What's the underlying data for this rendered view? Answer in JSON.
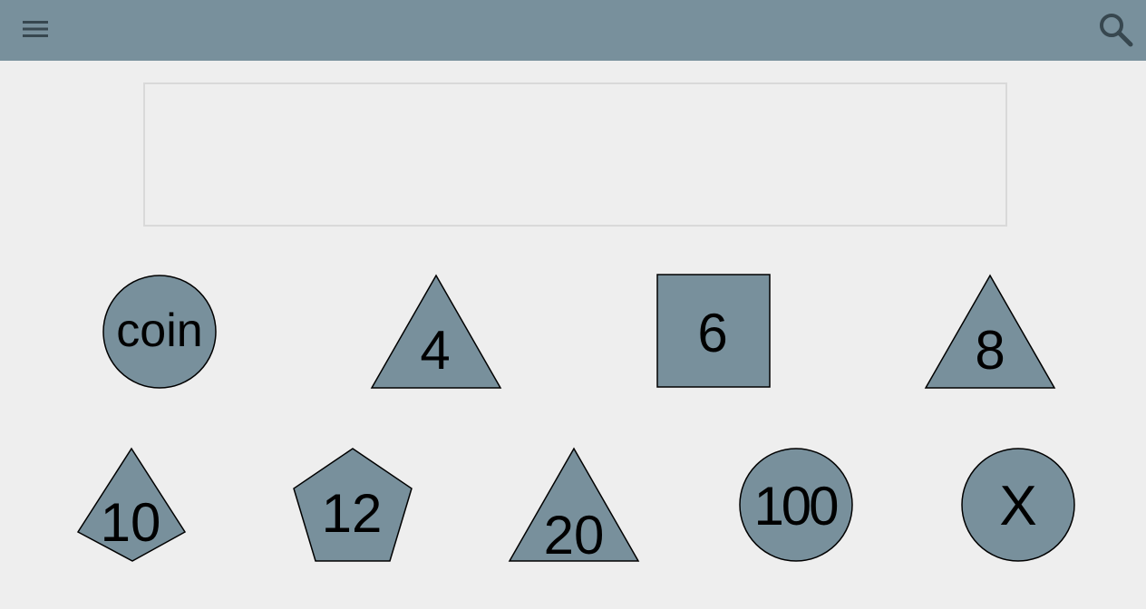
{
  "appbar": {
    "menu_icon": "hamburger-menu-icon",
    "search_icon": "search-icon",
    "color": "#78909c"
  },
  "result": {
    "value": ""
  },
  "dice": [
    {
      "label": "coin",
      "shape": "circle"
    },
    {
      "label": "4",
      "shape": "triangle"
    },
    {
      "label": "6",
      "shape": "square"
    },
    {
      "label": "8",
      "shape": "triangle"
    },
    {
      "label": "10",
      "shape": "kite"
    },
    {
      "label": "12",
      "shape": "pentagon"
    },
    {
      "label": "20",
      "shape": "triangle"
    },
    {
      "label": "100",
      "shape": "circle"
    },
    {
      "label": "X",
      "shape": "circle"
    }
  ],
  "colors": {
    "die_fill": "#78909c",
    "background": "#eeeeee"
  }
}
